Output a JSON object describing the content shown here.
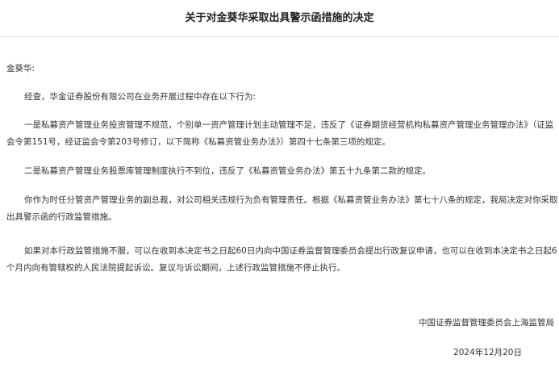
{
  "document": {
    "title": "关于对金葵华采取出具警示函措施的决定",
    "salutation": "金葵华:",
    "paragraphs": [
      "经查，华金证券股份有限公司在业务开展过程中存在以下行为:",
      "一是私募资产管理业务投资管理不规范，个别单一资产管理计划主动管理不足，违反了《证券期货经营机构私募资产管理业务管理办法》（证监会令第151号，经证监会令第203号修订，以下简称《私募资管业务办法》）第四十七条第三项的规定。",
      "二是私募资产管理业务股票库管理制度执行不到位，违反了《私募资管业务办法》第五十九条第二款的规定。",
      "你作为时任分管资产管理业务的副总裁，对公司相关违规行为负有管理责任。根据《私募资管业务办法》第七十八条的规定，我局决定对你采取出具警示函的行政监管措施。",
      "如果对本行政监管措施不服，可以在收到本决定书之日起60日内向中国证券监督管理委员会提出行政复议申请，也可以在收到本决定书之日起6个月内向有管辖权的人民法院提起诉讼。复议与诉讼期间，上述行政监管措施不停止执行。"
    ],
    "signature": "中国证券监督管理委员会上海监管局",
    "date": "2024年12月20日"
  }
}
